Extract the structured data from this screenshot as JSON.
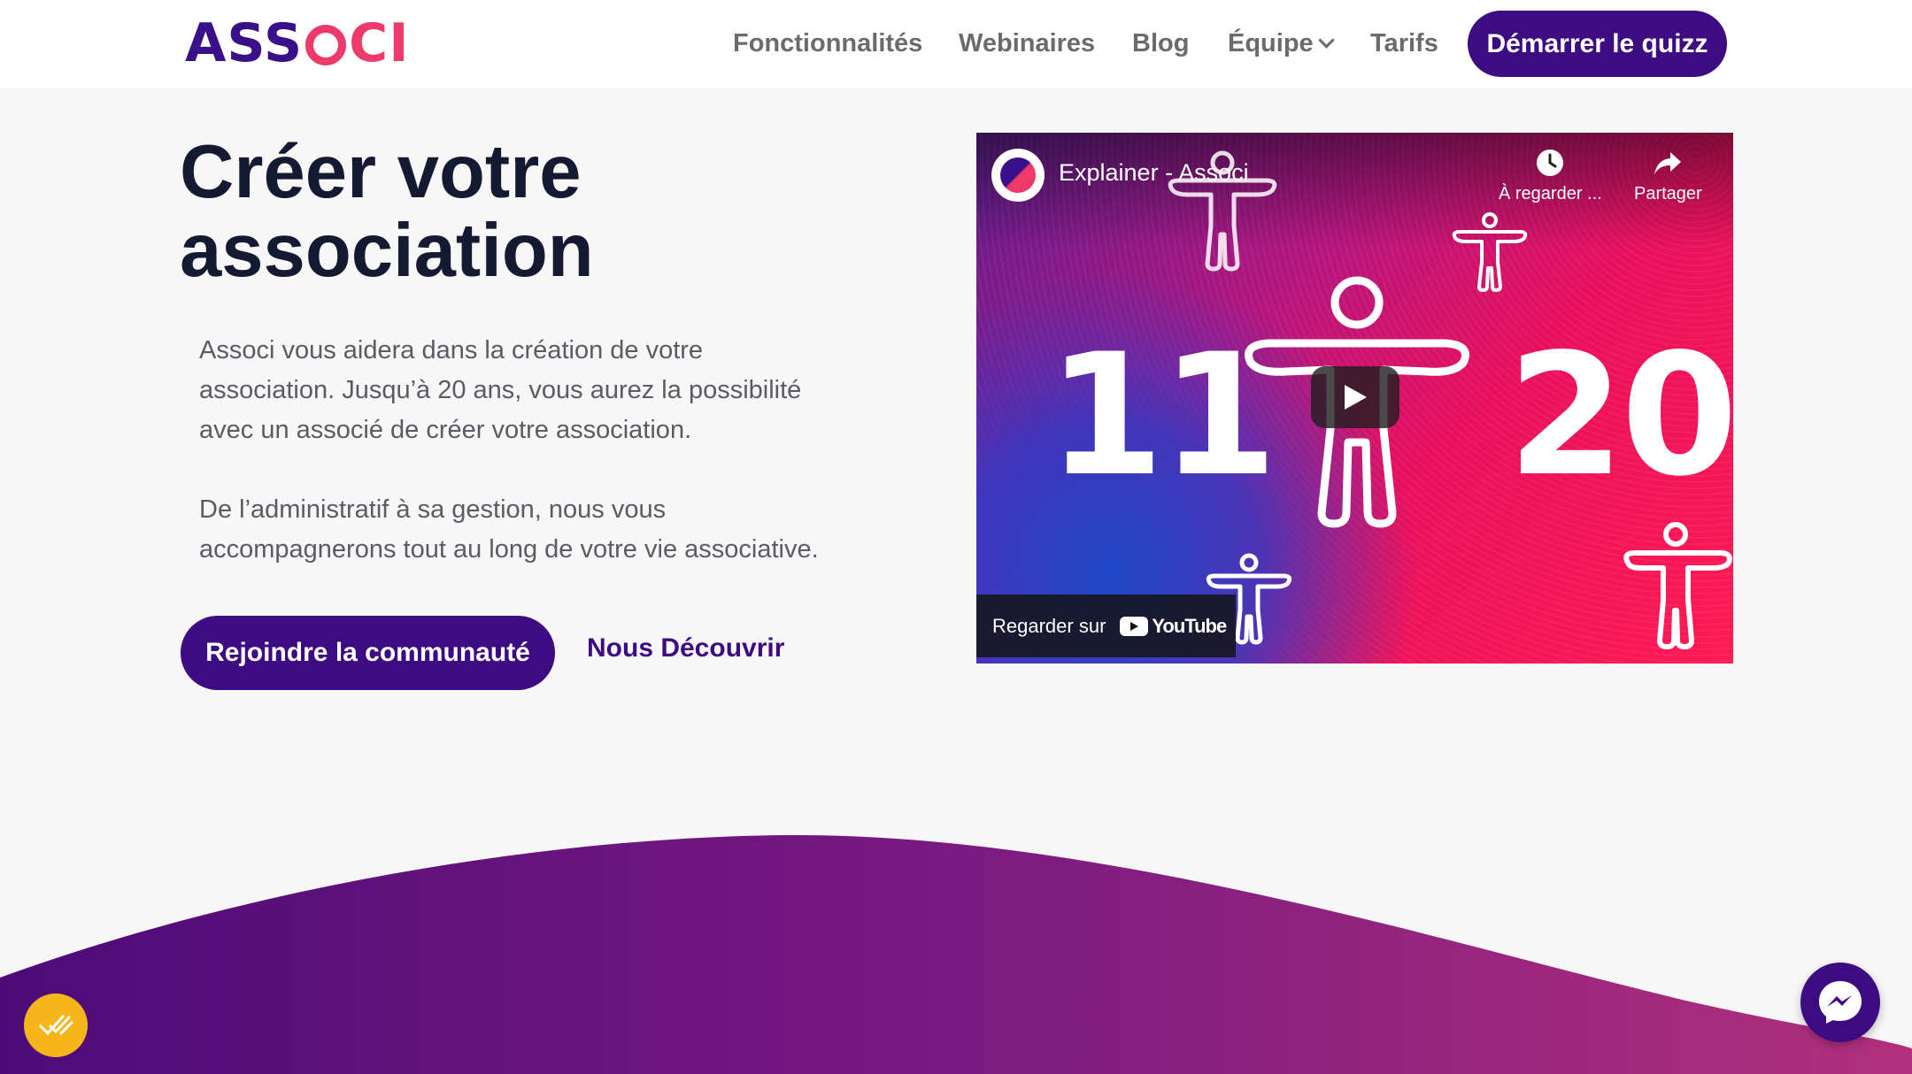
{
  "header": {
    "logo_parts": [
      "ASS",
      "CI"
    ],
    "nav": [
      {
        "label": "Fonctionnalités"
      },
      {
        "label": "Webinaires"
      },
      {
        "label": "Blog"
      },
      {
        "label": "Équipe"
      },
      {
        "label": "Tarifs"
      }
    ],
    "cta_label": "Démarrer le quizz"
  },
  "hero": {
    "title_lines": [
      "Créer votre",
      "association"
    ],
    "paragraph1_lines": [
      "Associ vous aidera dans la création de votre",
      "association. Jusqu’à 20 ans, vous aurez la possibilité",
      "avec un associé de créer votre association."
    ],
    "paragraph2_lines": [
      "De l’administratif à sa gestion, nous vous",
      "accompagnerons tout au long de votre vie associative."
    ],
    "primary_button": "Rejoindre la communauté",
    "secondary_link": "Nous Découvrir"
  },
  "video": {
    "title": "Explainer - Associ",
    "watch_later": "À regarder ...",
    "share": "Partager",
    "number_left": "11",
    "number_right": "20",
    "watch_on": "Regarder sur",
    "platform": "YouTube"
  },
  "colors": {
    "brand_purple": "#3d0b82",
    "brand_pink": "#ee3a6a",
    "badge_yellow": "#f6b519",
    "wave_start": "#4d0b7a",
    "wave_end": "#b1307c"
  },
  "icons": {
    "watch_later": "clock-icon",
    "share": "share-arrow-icon",
    "play": "play-icon",
    "messenger": "messenger-icon",
    "badge": "checkmark-icon"
  }
}
